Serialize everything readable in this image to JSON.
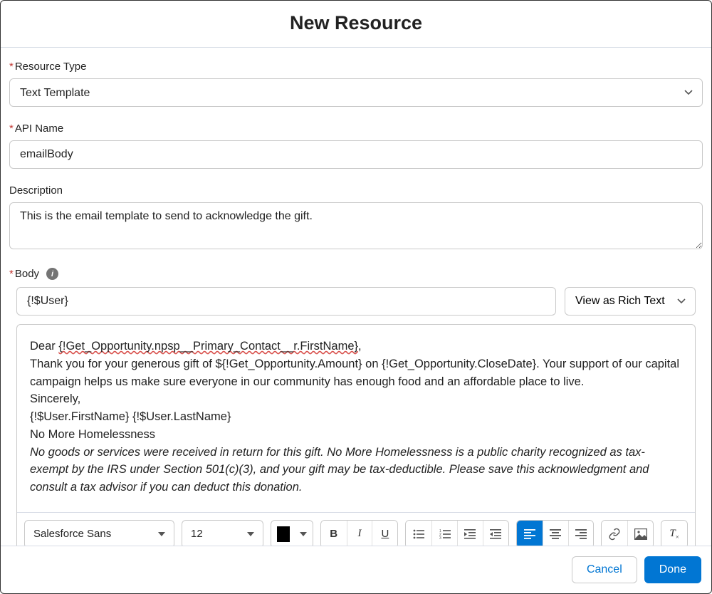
{
  "header": {
    "title": "New Resource"
  },
  "resourceType": {
    "label": "Resource Type",
    "value": "Text Template"
  },
  "apiName": {
    "label": "API Name",
    "value": "emailBody"
  },
  "description": {
    "label": "Description",
    "value": "This is the email template to send to acknowledge the gift."
  },
  "body": {
    "label": "Body",
    "merge_field": "{!$User}",
    "view_mode": "View as Rich Text",
    "line1_prefix": "Dear ",
    "line1_merge": "{!Get_Opportunity.npsp__Primary_Contact__r.FirstName}",
    "line1_suffix": ",",
    "line2": "Thank you for your generous gift of ${!Get_Opportunity.Amount} on {!Get_Opportunity.CloseDate}. Your support of our capital campaign helps us make sure everyone in our community has enough food and an affordable place to live.",
    "line3": "Sincerely,",
    "line4": "{!$User.FirstName} {!$User.LastName}",
    "line5": "No More Homelessness",
    "line6": "No goods or services were received in return for this gift. No More Homelessness is a public charity recognized as tax-exempt by the IRS under Section 501(c)(3), and your gift may be tax-deductible. Please save this acknowledgment and consult a tax advisor if you can deduct this donation."
  },
  "toolbar": {
    "font": "Salesforce Sans",
    "size": "12",
    "color": "#000000"
  },
  "footer": {
    "cancel": "Cancel",
    "done": "Done"
  }
}
